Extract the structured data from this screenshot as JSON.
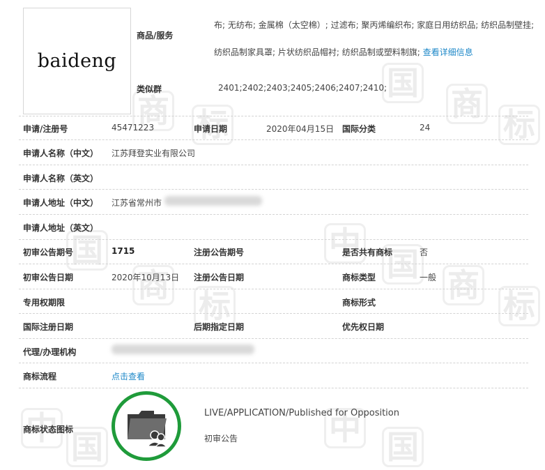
{
  "mark": {
    "text": "baideng"
  },
  "goods": {
    "label": "商品/服务",
    "text": "布; 无纺布; 金属棉（太空棉）; 过滤布; 聚丙烯编织布; 家庭日用纺织品; 纺织品制壁挂; 纺织品制家具罩; 片状纺织品帽衬; 纺织品制或塑料制旗;",
    "detail_link": "查看详细信息"
  },
  "similar_group": {
    "label": "类似群",
    "value": "2401;2402;2403;2405;2406;2407;2410;"
  },
  "fields": {
    "reg_no_label": "申请/注册号",
    "reg_no": "45471223",
    "app_date_label": "申请日期",
    "app_date": "2020年04月15日",
    "intl_class_label": "国际分类",
    "intl_class": "24",
    "applicant_cn_label": "申请人名称（中文）",
    "applicant_cn": "江苏拜登实业有限公司",
    "applicant_en_label": "申请人名称（英文）",
    "address_cn_label": "申请人地址（中文）",
    "address_cn": "江苏省常州市",
    "address_en_label": "申请人地址（英文）",
    "prelim_issue_label": "初审公告期号",
    "prelim_issue": "1715",
    "reg_issue_label": "注册公告期号",
    "shared_label": "是否共有商标",
    "shared": "否",
    "prelim_date_label": "初审公告日期",
    "prelim_date": "2020年10月13日",
    "reg_date_label": "注册公告日期",
    "type_label": "商标类型",
    "type": "一般",
    "exclusive_label": "专用权期限",
    "form_label": "商标形式",
    "intl_reg_date_label": "国际注册日期",
    "later_date_label": "后期指定日期",
    "priority_label": "优先权日期",
    "agent_label": "代理/办理机构",
    "flow_label": "商标流程",
    "flow_link": "点击查看",
    "status_icon_label": "商标状态图标"
  },
  "status": {
    "en": "LIVE/APPLICATION/Published for Opposition",
    "cn": "初审公告"
  },
  "colors": {
    "link": "#1e88c8",
    "status_ring": "#1f9b3a",
    "icon_dark": "#3a3a3a"
  }
}
